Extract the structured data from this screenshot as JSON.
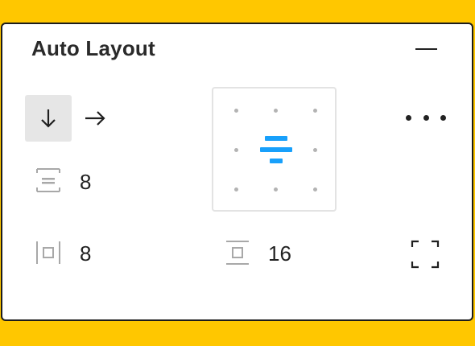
{
  "panel": {
    "title": "Auto Layout",
    "collapse_icon": "minus-icon",
    "direction": {
      "options": [
        {
          "name": "vertical",
          "icon": "arrow-down-icon",
          "selected": true
        },
        {
          "name": "horizontal",
          "icon": "arrow-right-icon",
          "selected": false
        }
      ]
    },
    "spacing_between": {
      "icon": "spacing-between-icon",
      "value": "8"
    },
    "padding_horizontal": {
      "icon": "horizontal-padding-icon",
      "value": "8"
    },
    "padding_vertical": {
      "icon": "vertical-padding-icon",
      "value": "16"
    },
    "alignment": {
      "selected": "center",
      "accent": "#18A0FB"
    },
    "more_icon": "more-options-icon",
    "clip_icon": "clip-content-icon"
  }
}
